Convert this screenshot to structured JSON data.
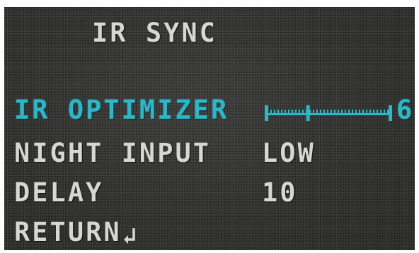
{
  "osd_menu": {
    "title": "IR SYNC",
    "items": [
      {
        "label": "IR OPTIMIZER",
        "value": "6",
        "control": "slider",
        "slider_level": 6,
        "slider_max": 6,
        "active": true
      },
      {
        "label": "NIGHT INPUT",
        "value": "LOW",
        "active": false
      },
      {
        "label": "DELAY",
        "value": "10",
        "active": false
      },
      {
        "label": "RETURN",
        "icon": "return-arrow-icon",
        "active": false
      }
    ]
  },
  "colors": {
    "text": "#d6d6d2",
    "highlight": "#2fb6c6",
    "background": "#2f2f2d"
  }
}
